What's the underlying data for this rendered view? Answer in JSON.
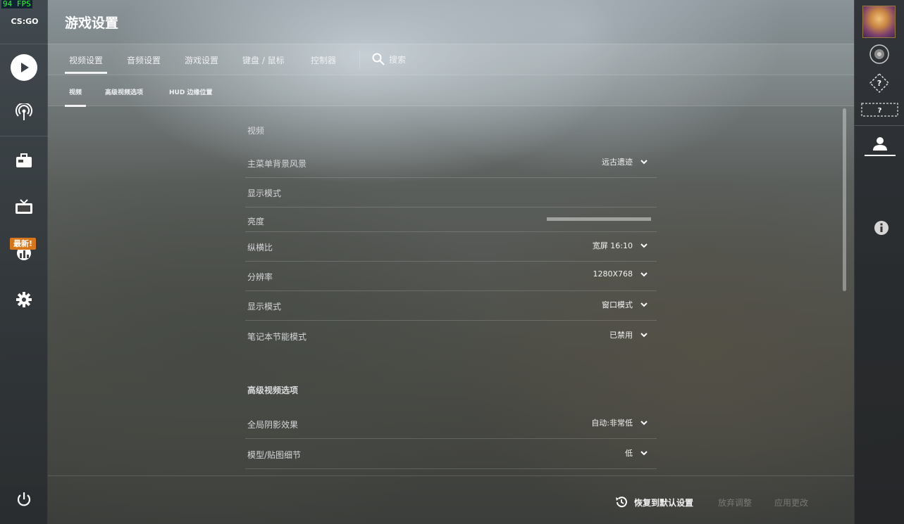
{
  "fps": "94 FPS",
  "app": {
    "logo": "CS:GO"
  },
  "left_nav": {
    "new_badge": "最新!"
  },
  "header": {
    "title": "游戏设置",
    "tabs": [
      "视频设置",
      "音频设置",
      "游戏设置",
      "键盘 / 鼠标",
      "控制器"
    ],
    "search_label": "搜索",
    "subtabs": [
      "视频",
      "高级视频选项",
      "HUD 边缘位置"
    ]
  },
  "video": {
    "section_title": "视频",
    "rows": [
      {
        "label": "主菜单背景风景",
        "value": "远古遗迹"
      },
      {
        "label": "显示模式",
        "value": ""
      },
      {
        "label": "亮度",
        "value": ""
      },
      {
        "label": "纵横比",
        "value": "宽屏 16:10"
      },
      {
        "label": "分辨率",
        "value": "1280X768"
      },
      {
        "label": "显示模式",
        "value": "窗口模式"
      },
      {
        "label": "笔记本节能模式",
        "value": "已禁用"
      }
    ]
  },
  "advanced": {
    "section_title": "高级视频选项",
    "rows": [
      {
        "label": "全局阴影效果",
        "value": "自动:非常低"
      },
      {
        "label": "模型/贴图细节",
        "value": "低"
      }
    ]
  },
  "footer": {
    "restore": "恢复到默认设置",
    "discard": "放弃调整",
    "apply": "应用更改"
  },
  "colors": {
    "accent": "#f2f2f2",
    "badge": "#d8761a",
    "fps": "#2aff2a"
  },
  "icons": [
    "play-icon",
    "broadcast-icon",
    "inventory-icon",
    "tv-icon",
    "stats-icon",
    "settings-icon",
    "power-icon",
    "search-icon",
    "restore-icon",
    "rank-icon",
    "unknown-rank-icon",
    "unknown-badge-icon",
    "profile-icon",
    "info-icon"
  ]
}
